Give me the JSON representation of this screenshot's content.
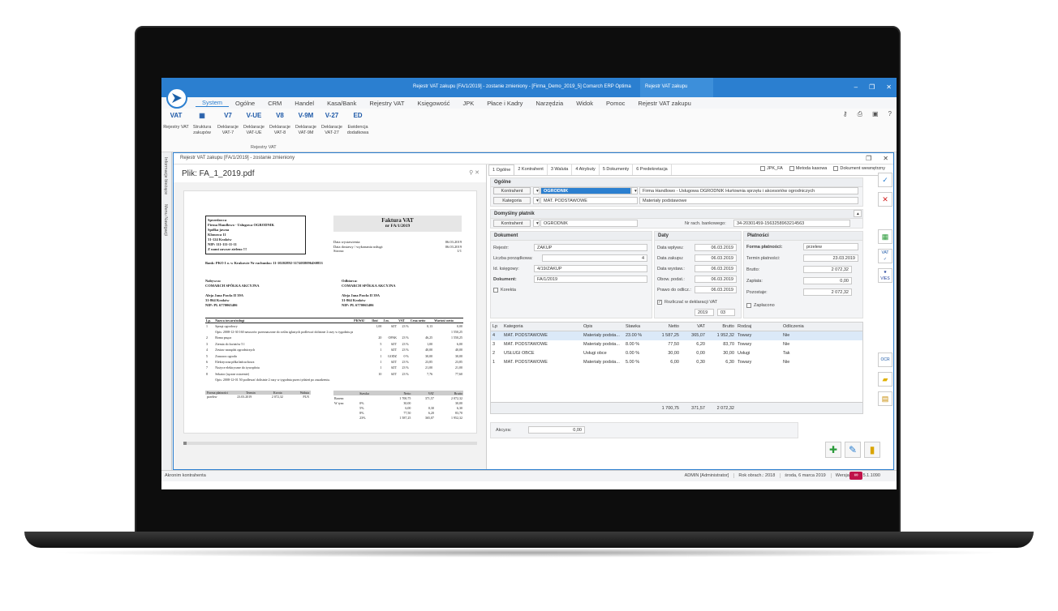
{
  "titlebar": {
    "title": "Rejestr VAT zakupu [FA/1/2019] - zostanie zmieniony - [Firma_Demo_2019_5] Comarch ERP Optima",
    "context_tab": "Rejestr VAT zakupu"
  },
  "menu": [
    "System",
    "Ogólne",
    "CRM",
    "Handel",
    "Kasa/Bank",
    "Rejestry VAT",
    "Księgowość",
    "JPK",
    "Płace i Kadry",
    "Narzędzia",
    "Widok",
    "Pomoc",
    "Rejestr VAT zakupu"
  ],
  "ribbon": {
    "buttons": [
      {
        "icon": "VAT",
        "label": "Rejestry VAT"
      },
      {
        "icon": "▦",
        "label": "Struktura zakupów"
      },
      {
        "icon": "V7",
        "label": "Deklaracje VAT-7"
      },
      {
        "icon": "V-UE",
        "label": "Deklaracje VAT-UE"
      },
      {
        "icon": "V8",
        "label": "Deklaracje VAT-8"
      },
      {
        "icon": "V-9M",
        "label": "Deklaracje VAT-9M"
      },
      {
        "icon": "V-27",
        "label": "Deklaracje VAT-27"
      },
      {
        "icon": "ED",
        "label": "Ewidencja dodatkowa"
      }
    ],
    "group": "Rejestry VAT"
  },
  "vtabs": [
    "Informacje bieżące",
    "Menu Nawigacji"
  ],
  "doc": {
    "title": "Rejestr VAT zakupu [FA/1/2019] - zostanie zmieniony",
    "file": "Plik: FA_1_2019.pdf"
  },
  "pdf": {
    "seller": [
      "Sprzedawca",
      "Firma Handlowo - Usługowa OGRODNIK",
      "Spółka jawna",
      "Klonowa 11",
      "31-124 Kraków",
      "NIP: 111-111-11-11",
      "Z nami zawsze zieleno !!!"
    ],
    "invoice_title": "Faktura VAT",
    "invoice_no": "nr FA/1/2019",
    "dates": [
      [
        "Data wystawienia:",
        "06.03.2019"
      ],
      [
        "Data dostawy / wykonania usługi:",
        "06.03.2019"
      ],
      [
        "Strona:",
        "1/1"
      ]
    ],
    "bank": "Bank: PKO I o. w Krakowie  Nr rachunku: 11-10202892-31740580964S0853",
    "buyer": [
      "Nabywca:",
      "COMARCH SPÓŁKA AKCYJNA",
      "",
      "Aleja Jana Pawła II 39A",
      "31-864 Kraków",
      "NIP: PL 6770065406"
    ],
    "recipient": [
      "Odbiorca:",
      "COMARCH SPÓŁKA AKCYJNA",
      "",
      "Aleja Jana Pawła II 39A",
      "31-864 Kraków",
      "NIP: PL 6770065406"
    ],
    "table_head": [
      "Lp.",
      "Nazwa towaru/usługi",
      "PKWiU",
      "Ilość",
      "J.m.",
      "VAT",
      "Cena netto",
      "Wartość netto"
    ],
    "rows": [
      [
        "1",
        "Sprzęt ogrodowy",
        "",
        "1,00",
        "SZT",
        "23 %",
        "0,13",
        "0,00"
      ],
      [
        "",
        "Opis: 2008-12-30 160 nawozów przeznaczone do roślin iglastych podlewać dolistnie 2 razy w tygodniu przez tydzień po zasadzeniu zalecane do zakupu...",
        "",
        "",
        "",
        "",
        "",
        "1 550,25"
      ],
      [
        "2",
        "Roma pnąca",
        "",
        "20",
        "OPAK",
        "23 %",
        "46,25",
        "1 550,25"
      ],
      [
        "3",
        "Ziemia do kwiatów 5 l",
        "",
        "5",
        "SZT",
        "23 %",
        "1,00",
        "6,00"
      ],
      [
        "4",
        "Zestaw narzędzi ogrodniczych",
        "",
        "1",
        "SZT",
        "23 %",
        "40,00",
        "40,00"
      ],
      [
        "5",
        "Zraszacz ogrodu",
        "",
        "1",
        "GODZ",
        "0 %",
        "30,00",
        "30,00"
      ],
      [
        "6",
        "Elektryczna piłka łańcuchowa",
        "",
        "1",
        "SZT",
        "23 %",
        "23,85",
        "23,85"
      ],
      [
        "7",
        "Nożyce elektryczne do żywopłotu",
        "",
        "1",
        "SZT",
        "23 %",
        "21,00",
        "21,00"
      ],
      [
        "8",
        "Sekator (ręczne ostrzenie)",
        "",
        "10",
        "SZT",
        "23 %",
        "7,76",
        "77,60"
      ],
      [
        "",
        "Opis: 2008-12-01 50 podlewać dolistnie 2 razy w tygodniu przez tydzień po zasadzeniu.",
        "",
        "",
        "",
        "",
        "",
        ""
      ]
    ],
    "pay_head": [
      "Forma płatności",
      "Termin",
      "Kwota",
      "Waluta"
    ],
    "pay_row": [
      "przelew",
      "23.03.2019",
      "2 072,32",
      "PLN"
    ],
    "sum_head": [
      "",
      "Stawka",
      "Netto",
      "VAT",
      "Brutto"
    ],
    "sum_rows": [
      [
        "Razem:",
        "",
        "1 700,75",
        "371,57",
        "2 072,32"
      ],
      [
        "W tym:",
        "0%",
        "30,00",
        "",
        "30,00"
      ],
      [
        "",
        "5%",
        "6,00",
        "0,30",
        "6,30"
      ],
      [
        "",
        "8%",
        "77,50",
        "6,20",
        "83,70"
      ],
      [
        "",
        "23%",
        "1 587,25",
        "365,07",
        "1 952,32"
      ]
    ]
  },
  "form": {
    "tabs": [
      "1 Ogólne",
      "2 Kontrahent",
      "3 Waluta",
      "4 Atrybuty",
      "5 Dokumenty",
      "6 Predekretacja"
    ],
    "checks": [
      "JPK_FA",
      "Metoda kasowa",
      "Dokument wewnętrzny"
    ],
    "ogolne": {
      "header": "Ogólne",
      "kontrahent_btn": "Kontrahent",
      "kontrahent_val": "OGRODNIK",
      "kontrahent_name": "Firma Handlowo - Usługowa OGRODNIK Hurtownia sprzętu i akcesoriów ogrodniczych",
      "kategoria_btn": "Kategoria",
      "kategoria_val": "MAT. PODSTAWOWE",
      "kategoria_desc": "Materiały podstawowe"
    },
    "platnik": {
      "header": "Domyślny płatnik",
      "btn": "Kontrahent",
      "val": "OGRODNIK",
      "rach_label": "Nr rach. bankowego:",
      "rach_val": "34-20301459-1563258963214563"
    },
    "dokument": {
      "header": "Dokument",
      "rejestr_l": "Rejestr:",
      "rejestr_v": "ZAKUP",
      "lp_l": "Liczba porządkowa:",
      "lp_v": "4",
      "idk_l": "Id. księgowy:",
      "idk_v": "4/19/ZAKUP",
      "dok_l": "Dokument:",
      "dok_v": "FA/1/2019",
      "korekta": "Korekta"
    },
    "daty": {
      "header": "Daty",
      "rows": [
        [
          "Data wpływu:",
          "06.03.2019"
        ],
        [
          "Data zakupu:",
          "06.03.2019"
        ],
        [
          "Data wystaw.:",
          "06.03.2019"
        ],
        [
          "Obow. podat.:",
          "06.03.2019"
        ],
        [
          "Prawo do odlicz.:",
          "06.03.2019"
        ]
      ],
      "rozliczac": "Rozliczać w deklaracji VAT",
      "rok": "2019",
      "mies": "03"
    },
    "platnosci": {
      "header": "Płatności",
      "forma_l": "Forma płatności:",
      "forma_v": "przelew",
      "termin_l": "Termin płatności:",
      "termin_v": "23.03.2019",
      "brutto_l": "Brutto:",
      "brutto_v": "2 072,32",
      "zaplata_l": "Zapłata:",
      "zaplata_v": "0,00",
      "pozostaje_l": "Pozostaje:",
      "pozostaje_v": "2 072,32",
      "zaplacono": "Zapłacono"
    },
    "grid_head": [
      "Lp",
      "Kategoria",
      "Opis",
      "Stawka",
      "Netto",
      "VAT",
      "Brutto",
      "Rodzaj",
      "Odliczenia"
    ],
    "grid_rows": [
      [
        "4",
        "MAT. PODSTAWOWE",
        "Materiały podsta...",
        "23.00 %",
        "1 587,25",
        "365,07",
        "1 952,32",
        "Towary",
        "Nie"
      ],
      [
        "3",
        "MAT. PODSTAWOWE",
        "Materiały podsta...",
        "8.00 %",
        "77,50",
        "6,20",
        "83,70",
        "Towary",
        "Nie"
      ],
      [
        "2",
        "USŁUGI OBCE",
        "Usługi obce",
        "0.00 %",
        "30,00",
        "0,00",
        "30,00",
        "Usługi",
        "Tak"
      ],
      [
        "1",
        "MAT. PODSTAWOWE",
        "Materiały podsta...",
        "5.00 %",
        "6,00",
        "0,30",
        "6,30",
        "Towary",
        "Nie"
      ]
    ],
    "grid_foot": [
      "1 700,75",
      "371,57",
      "2 072,32"
    ],
    "akcyza_l": "Akcyza:",
    "akcyza_v": "0,00"
  },
  "status": {
    "left": "Akronim kontrahenta",
    "user": "ADMIN [Administrator]",
    "year": "Rok obrach.: 2018",
    "date": "środa, 6 marca 2019",
    "version": "Wersja: 2019.5.1.1090"
  },
  "colors": {
    "titlebar": "#2b7fd0",
    "accent": "#2b7fd0"
  }
}
